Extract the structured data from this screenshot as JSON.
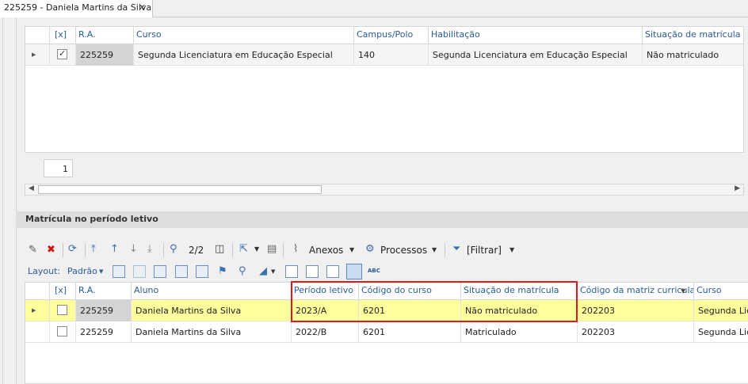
{
  "tab": {
    "title": "225259 - Daniela Martins da Silva",
    "close": "✕"
  },
  "top_grid": {
    "headers": [
      "[x]",
      "R.A.",
      "Curso",
      "Campus/Polo",
      "Habilitação",
      "Situação de matrícula"
    ],
    "rows": [
      {
        "checked": true,
        "ra": "225259",
        "curso": "Segunda Licenciatura em Educação Especial",
        "campus": "140",
        "habilitacao": "Segunda Licenciatura em Educação Especial",
        "situacao": "Não matriculado"
      }
    ],
    "page_number": "1"
  },
  "section": {
    "title": "Matrícula no período letivo"
  },
  "toolbar": {
    "edit_icon": "pencil-icon",
    "delete_icon": "delete-x-icon",
    "refresh_icon": "refresh-icon",
    "first_icon": "first-record-icon",
    "prev_icon": "previous-record-icon",
    "next_icon": "next-record-icon",
    "last_icon": "last-record-icon",
    "search_icon": "search-icon",
    "record_count": "2/2",
    "columns_icon": "columns-icon",
    "export_icon": "export-icon",
    "document_icon": "document-icon",
    "anexos_label": "Anexos",
    "processos_label": "Processos",
    "filter_label": "[Filtrar]"
  },
  "layout_bar": {
    "label": "Layout:",
    "padrao": "Padrão"
  },
  "bottom_grid": {
    "headers": [
      "[x]",
      "R.A.",
      "Aluno",
      "Período letivo",
      "Código do curso",
      "Situação de matrícula",
      "Código da matriz curricular",
      "Curso"
    ],
    "rows": [
      {
        "checked": false,
        "ra": "225259",
        "aluno": "Daniela Martins da Silva",
        "periodo": "2023/A",
        "codigo_curso": "6201",
        "situacao": "Não matriculado",
        "matriz": "202203",
        "curso": "Segunda Lic",
        "highlighted": true
      },
      {
        "checked": false,
        "ra": "225259",
        "aluno": "Daniela Martins da Silva",
        "periodo": "2022/B",
        "codigo_curso": "6201",
        "situacao": "Matriculado",
        "matriz": "202203",
        "curso": "Segunda Lic",
        "highlighted": false
      }
    ]
  },
  "colors": {
    "highlight_row": "#ffff9e",
    "header_text": "#2a5b9c",
    "annotation_box": "#e01818"
  }
}
